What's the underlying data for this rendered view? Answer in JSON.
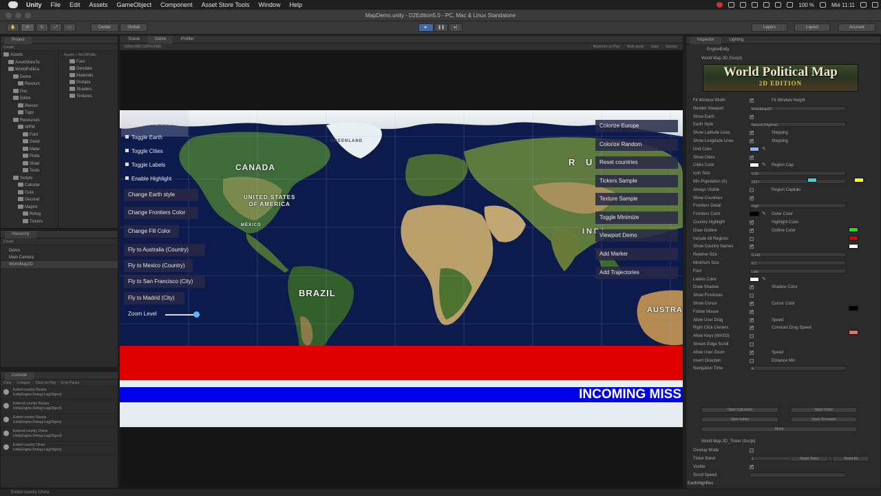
{
  "menubar": {
    "items": [
      "Unity",
      "File",
      "Edit",
      "Assets",
      "GameObject",
      "Component",
      "Asset Store Tools",
      "Window",
      "Help"
    ],
    "battery": "100 %",
    "clock": "Mié 11:11"
  },
  "window": {
    "title": "MapDemo.unity - D2Edition5.0 - PC, Mac & Linux Standalone"
  },
  "toolbar": {
    "pivot": "Center",
    "space": "Global",
    "layers": "Layers",
    "layout": "Layout",
    "account": "Account"
  },
  "project": {
    "tab": "Project",
    "create": "Create",
    "tree": [
      {
        "label": "Assets",
        "indent": 0
      },
      {
        "label": "AssetStoreTo",
        "indent": 1
      },
      {
        "label": "WorldPolitica",
        "indent": 1
      },
      {
        "label": "Demo",
        "indent": 2
      },
      {
        "label": "Resourc",
        "indent": 3
      },
      {
        "label": "Doc",
        "indent": 2
      },
      {
        "label": "Editor",
        "indent": 2
      },
      {
        "label": "Resour",
        "indent": 3
      },
      {
        "label": "Tiqui",
        "indent": 3
      },
      {
        "label": "Resources",
        "indent": 2
      },
      {
        "label": "WPM",
        "indent": 3
      },
      {
        "label": "Font",
        "indent": 4
      },
      {
        "label": "Geod",
        "indent": 4
      },
      {
        "label": "Mater",
        "indent": 4
      },
      {
        "label": "Prefa",
        "indent": 4
      },
      {
        "label": "Shad",
        "indent": 4
      },
      {
        "label": "Textu",
        "indent": 4
      },
      {
        "label": "Scripts",
        "indent": 2
      },
      {
        "label": "Calcular",
        "indent": 3
      },
      {
        "label": "Core",
        "indent": 3
      },
      {
        "label": "Decorat",
        "indent": 3
      },
      {
        "label": "MapInt",
        "indent": 3
      },
      {
        "label": "Refug",
        "indent": 4
      },
      {
        "label": "Tickers",
        "indent": 4
      }
    ],
    "breadcrumb": "Assets > WorldPolitic",
    "folders": [
      "Font",
      "Geodata",
      "Materials",
      "Prefabs",
      "Shaders",
      "Textures"
    ]
  },
  "hierarchy": {
    "tab": "Hierarchy",
    "create": "Create",
    "items": [
      "Demo",
      "Main Camera",
      "WorldMap2D"
    ]
  },
  "console": {
    "tab": "Console",
    "toolbar": [
      "Clear",
      "Collapse",
      "Clear on Play",
      "Error Pause"
    ],
    "logs": [
      {
        "line1": "Exited country Russia",
        "line2": "UnityEngine.Debug:Log(Object)"
      },
      {
        "line1": "Entered country Russia",
        "line2": "UnityEngine.Debug:Log(Object)"
      },
      {
        "line1": "Exited country Russia",
        "line2": "UnityEngine.Debug:Log(Object)"
      },
      {
        "line1": "Entered country China",
        "line2": "UnityEngine.Debug:Log(Object)"
      },
      {
        "line1": "Exited country China",
        "line2": "UnityEngine.Debug:Log(Object)"
      }
    ]
  },
  "views": {
    "tabs": [
      "Scene",
      "Game",
      "Profiler"
    ],
    "resolution": "1920x1080 (1920x1080)",
    "options": [
      "Maximize on Play",
      "Mute audio",
      "Stats",
      "Gizmos"
    ]
  },
  "game": {
    "toggles": [
      "Toggle Frontiers",
      "Toggle Earth",
      "Toggle Cities",
      "Toggle Labels",
      "Enable Highlight"
    ],
    "left_buttons": [
      "Change Earth style",
      "Change Frontiers Color",
      "Change Fill Color",
      "Fly to Australia (Country)",
      "Fly to Mexico (Country)",
      "Fly to San Francisco (City)",
      "Fly to Madrid (City)"
    ],
    "zoom_label": "Zoom Level",
    "zoom_value": 0.9,
    "right_buttons": [
      "Colorize Europe",
      "Colorize Random",
      "Reset countries",
      "Tickers Sample",
      "Texture Sample",
      "Toggle Minimize",
      "Viewport Demo",
      "Add Marker",
      "Add Trajectories"
    ],
    "map_labels": {
      "canada": "CANADA",
      "usa": "UNITED STATES\nOF AMERICA",
      "mexico": "MÉXICO",
      "brazil": "BRAZIL",
      "russia": "R U",
      "india": "INDI",
      "australia": "AUSTRA",
      "greenland": "GREENLAND"
    },
    "ticker_text": "INCOMING MISS"
  },
  "inspector": {
    "tabs": [
      "Inspector",
      "Lighting"
    ],
    "object_name": "EngineBody",
    "component": "World Map 2D (Script)",
    "banner_title": "World Political Map",
    "banner_sub": "2D EDITION",
    "rows": [
      {
        "label": "Fit Window Width",
        "check": true,
        "right": "Fit Window Height"
      },
      {
        "label": "Render Viewport",
        "value": "WorldMap2D"
      },
      {
        "label": "Show Earth",
        "check": true
      },
      {
        "label": "Earth Style",
        "value": "Natural (Highres)"
      },
      {
        "label": "Show Latitude Lines",
        "check": true,
        "right": "Stepping"
      },
      {
        "label": "Show Longitude Lines",
        "check": true,
        "right": "Stepping"
      },
      {
        "label": "Grid Color",
        "swatch": "#8fb5e6"
      },
      {
        "label": "Show Cities",
        "check": true
      },
      {
        "label": "Cities Color",
        "swatch": "#ffffff",
        "right": "Region Cap."
      },
      {
        "label": "Icon Size",
        "value": "0.05"
      },
      {
        "label": "Min Population (K)",
        "value": "2227"
      },
      {
        "label": "Always Visible",
        "check": false,
        "right": "Region Capitals"
      },
      {
        "label": "Show Countries",
        "check": true
      },
      {
        "label": "Frontiers Detail",
        "value": "High"
      },
      {
        "label": "Frontiers Color",
        "swatch": "#000000",
        "right": "Outer Color"
      },
      {
        "label": "Country Highlight",
        "check": true,
        "right": "Highlight Color"
      },
      {
        "label": "Draw Outline",
        "check": true,
        "right": "Outline Color"
      },
      {
        "label": "Include All Regions",
        "check": false
      },
      {
        "label": "Show Country Names",
        "check": true
      },
      {
        "label": "Relative Size",
        "value": "0.142"
      },
      {
        "label": "Minimum Size",
        "value": "0.2"
      },
      {
        "label": "Font",
        "value": "Lato"
      },
      {
        "label": "Labels Color",
        "swatch": "#ffffff"
      },
      {
        "label": "Draw Shadow",
        "check": true,
        "right": "Shadow Color"
      },
      {
        "label": "Show Provinces",
        "check": false
      },
      {
        "label": "Show Cursor",
        "check": true,
        "right": "Cursor Color"
      },
      {
        "label": "Follow Mouse",
        "check": true
      },
      {
        "label": "Allow User Drag",
        "check": true,
        "right": "Speed"
      },
      {
        "label": "Right Click Centers",
        "check": true,
        "right": "Constant Drag Speed"
      },
      {
        "label": "Allow Keys (WASD)",
        "check": false
      },
      {
        "label": "Screen Edge Scroll",
        "check": false
      },
      {
        "label": "Allow User Zoom",
        "check": true,
        "right": "Speed"
      },
      {
        "label": "Invert Direction",
        "check": false,
        "right": "Distance Min"
      },
      {
        "label": "Navigation Time",
        "value": "4"
      }
    ],
    "buttons": [
      "Open Calculator",
      "Open Ticker",
      "Open Editor",
      "Open Decorator",
      "About"
    ],
    "component2": "World Map 2D_Ticker (Script)",
    "rows2": [
      {
        "label": "Overlay Mode",
        "check": false
      },
      {
        "label": "Ticker Band",
        "value": "1"
      },
      {
        "label": "Visible",
        "check": true
      },
      {
        "label": "Scroll Speed",
        "value": ""
      }
    ],
    "rows2_buttons": [
      "Reset Ticker",
      "Reset All"
    ],
    "footer": "EarthHighRes",
    "colors": {
      "region_cap": "#3ad3d3",
      "capital": "#ffff00",
      "outer": "#22dd22",
      "highlight": "#dd0000",
      "outline": "#ffffff",
      "shadow": "#000000",
      "cursor": "#e0756c"
    }
  },
  "status": "Exited country China"
}
